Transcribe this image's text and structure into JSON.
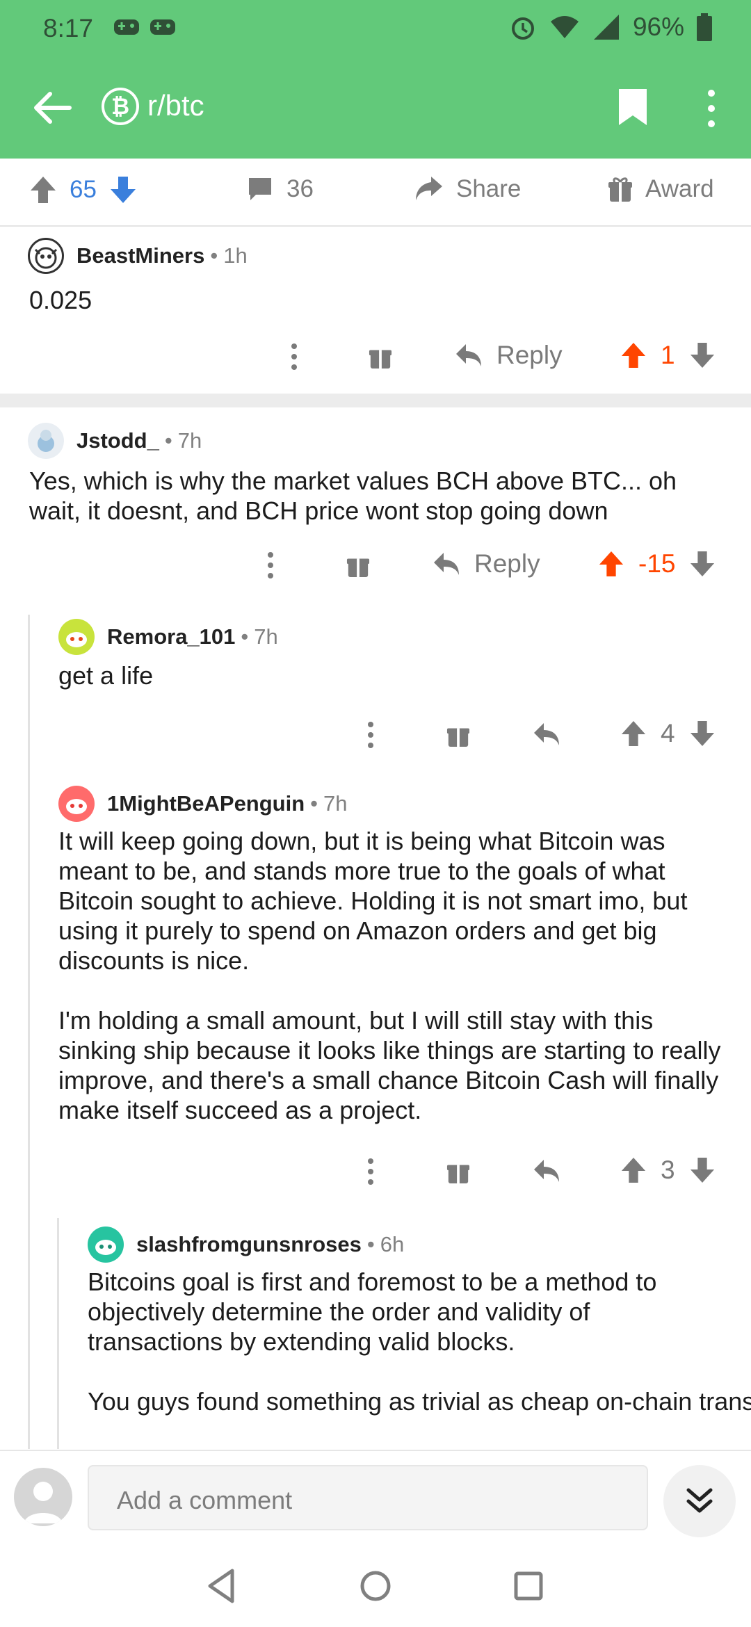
{
  "status_bar": {
    "time": "8:17",
    "battery": "96%"
  },
  "app_bar": {
    "subreddit": "r/btc"
  },
  "post_bar": {
    "score": "65",
    "comments": "36",
    "share_label": "Share",
    "award_label": "Award"
  },
  "comments": [
    {
      "author": "BeastMiners",
      "age": "1h",
      "paragraphs": [
        "0.025"
      ],
      "reply_label": "Reply",
      "score": "1"
    },
    {
      "author": "Jstodd_",
      "age": "7h",
      "paragraphs": [
        "Yes, which is why the market values BCH above BTC... oh wait, it doesnt, and BCH price wont stop going down"
      ],
      "reply_label": "Reply",
      "score": "-15"
    },
    {
      "author": "Remora_101",
      "age": "7h",
      "paragraphs": [
        "get a life"
      ],
      "score": "4"
    },
    {
      "author": "1MightBeAPenguin",
      "age": "7h",
      "paragraphs": [
        "It will keep going down, but it is being what Bitcoin was meant to be, and stands more true to the goals of what Bitcoin sought to achieve. Holding it is not smart imo, but using it purely to spend on Amazon orders and get big discounts is nice.",
        "I'm holding a small amount, but I will still stay with this sinking ship because it looks like things are starting to really improve, and there's a small chance Bitcoin Cash will finally make itself succeed as a project."
      ],
      "score": "3"
    },
    {
      "author": "slashfromgunsnroses",
      "age": "6h",
      "paragraphs": [
        "Bitcoins goal is first and foremost to be a method to objectively determine the order and validity of transactions by extending valid blocks.",
        "You guys found something as trivial as cheap on-chain transactions to be of highest importance, disregarding"
      ]
    }
  ],
  "composer": {
    "placeholder": "Add a comment"
  },
  "colors": {
    "brand_green": "#62c97a",
    "upvote_orange": "#ff4500",
    "vote_blue": "#3a7fdc",
    "meta_gray": "#7c7c7c"
  },
  "icons": [
    "back-arrow-icon",
    "bitcoin-icon",
    "bookmark-icon",
    "more-icon",
    "upvote-icon",
    "downvote-icon",
    "comment-icon",
    "share-icon",
    "award-icon",
    "reply-icon",
    "jump-down-icon"
  ]
}
